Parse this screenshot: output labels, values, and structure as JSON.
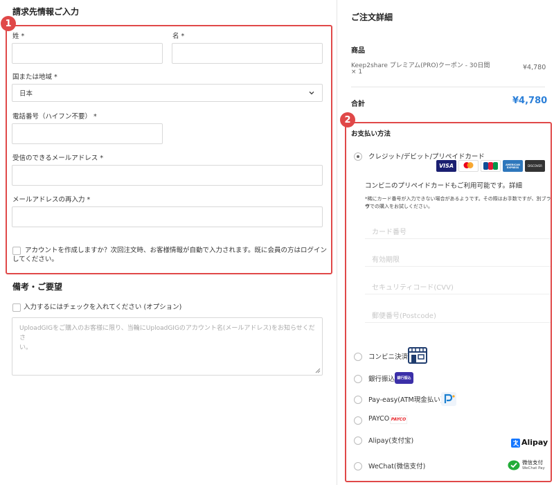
{
  "billing": {
    "title": "請求先情報ご入力",
    "last_name_label": "姓 *",
    "first_name_label": "名 *",
    "country_label": "国または地域 *",
    "country_value": "日本",
    "phone_label": "電話番号（ハイフン不要） *",
    "email_label": "受信のできるメールアドレス *",
    "email_confirm_label": "メールアドレスの再入力 *",
    "create_account_line1": "アカウントを作成しますか？次回注文時、お客様情報が自動で入力されます。既に会員の方はログイン",
    "create_account_line2": "してください。"
  },
  "notes": {
    "title": "備考・ご要望",
    "checkbox_label": "入力するにはチェックを入れてください (オプション)",
    "placeholder_line1": "UploadGIGをご購入のお客様に限り、当輪にUploadGIGのアカウント名(メールアドレス)をお知らせくださ",
    "placeholder_line2": "い。"
  },
  "order": {
    "title": "ご注文詳細",
    "product_header": "商品",
    "product_name": "Keep2share プレミアム(PRO)クーポン - 30日間",
    "product_qty": "× 1",
    "product_price": "¥4,780",
    "total_label": "合計",
    "total_value": "¥4,780"
  },
  "payment": {
    "title": "お支払い方法",
    "card_option": "クレジット/デビット/プリペイドカード",
    "card_logos": [
      "VISA",
      "Mastercard",
      "JCB",
      "AMERICAN EXPRESS",
      "DISCOVER"
    ],
    "card_info": "コンビニのプリペイドカードもご利用可能です。詳細",
    "card_note_line1": "*稀にカード番号が入力できない場合があるようです。その際はお手数ですが、別ブラウ",
    "card_note_line2": "ザでの購入をお試しください。",
    "card_number_placeholder": "カード番号",
    "expiry_placeholder": "有効期限",
    "cvv_placeholder": "セキュリティコード(CVV)",
    "postcode_placeholder": "郵便番号(Postcode)",
    "konbini": "コンビニ決済",
    "bank": "銀行振込",
    "bank_badge": "銀行振込",
    "payeasy": "Pay-easy(ATM現金払い)",
    "payco": "PAYCO",
    "payco_badge": "PAYCO",
    "alipay": "Alipay(支付宝)",
    "alipay_logo": "Alipay",
    "wechat": "WeChat(微信支付)",
    "wechat_logo_line1": "微信支付",
    "wechat_logo_line2": "WeChat Pay"
  },
  "callouts": [
    "1",
    "2"
  ],
  "colors": {
    "accent": "#e04848",
    "total": "#2b7fd8",
    "visa": "#1a1f71"
  },
  "icons": [
    "chevron-down-icon",
    "resize-grip-icon",
    "store-icon",
    "payeasy-icon",
    "alipay-icon",
    "wechat-icon"
  ]
}
